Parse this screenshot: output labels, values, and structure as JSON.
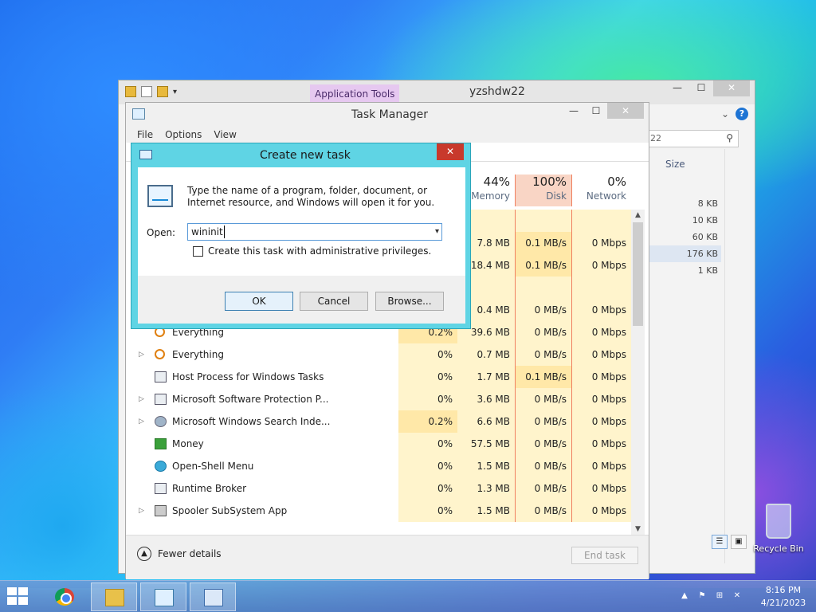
{
  "explorer": {
    "app_tools_label": "Application Tools",
    "title": "yzshdw22",
    "search_text": "22",
    "size_header": "Size",
    "sizes": [
      "8 KB",
      "10 KB",
      "60 KB",
      "176 KB",
      "1 KB"
    ],
    "selected_index": 3
  },
  "task_manager": {
    "title": "Task Manager",
    "menu": [
      "File",
      "Options",
      "View"
    ],
    "columns": {
      "memory": {
        "pct": "44%",
        "label": "Memory"
      },
      "disk": {
        "pct": "100%",
        "label": "Disk"
      },
      "network": {
        "pct": "0%",
        "label": "Network"
      }
    },
    "rows": [
      {
        "name": "",
        "cpu": "",
        "mem": "",
        "disk": "",
        "net": "",
        "icon": "none",
        "expander": false
      },
      {
        "name": "",
        "cpu": "",
        "mem": "7.8 MB",
        "disk": "0.1 MB/s",
        "net": "0 Mbps",
        "icon": "none",
        "expander": false
      },
      {
        "name": "",
        "cpu": "",
        "mem": "18.4 MB",
        "disk": "0.1 MB/s",
        "net": "0 Mbps",
        "icon": "none",
        "expander": false
      },
      {
        "name": "",
        "cpu": "",
        "mem": "",
        "disk": "",
        "net": "",
        "icon": "none",
        "expander": false
      },
      {
        "name": "",
        "cpu": "",
        "mem": "0.4 MB",
        "disk": "0 MB/s",
        "net": "0 Mbps",
        "icon": "none",
        "expander": false
      },
      {
        "name": "Everything",
        "cpu": "0.2%",
        "mem": "39.6 MB",
        "disk": "0 MB/s",
        "net": "0 Mbps",
        "icon": "search",
        "expander": false
      },
      {
        "name": "Everything",
        "cpu": "0%",
        "mem": "0.7 MB",
        "disk": "0 MB/s",
        "net": "0 Mbps",
        "icon": "search",
        "expander": true
      },
      {
        "name": "Host Process for Windows Tasks",
        "cpu": "0%",
        "mem": "1.7 MB",
        "disk": "0.1 MB/s",
        "net": "0 Mbps",
        "icon": "gen",
        "expander": false
      },
      {
        "name": "Microsoft Software Protection P...",
        "cpu": "0%",
        "mem": "3.6 MB",
        "disk": "0 MB/s",
        "net": "0 Mbps",
        "icon": "gen",
        "expander": true
      },
      {
        "name": "Microsoft Windows Search Inde...",
        "cpu": "0.2%",
        "mem": "6.6 MB",
        "disk": "0 MB/s",
        "net": "0 Mbps",
        "icon": "winsearch",
        "expander": true
      },
      {
        "name": "Money",
        "cpu": "0%",
        "mem": "57.5 MB",
        "disk": "0 MB/s",
        "net": "0 Mbps",
        "icon": "money",
        "expander": false
      },
      {
        "name": "Open-Shell Menu",
        "cpu": "0%",
        "mem": "1.5 MB",
        "disk": "0 MB/s",
        "net": "0 Mbps",
        "icon": "shell",
        "expander": false
      },
      {
        "name": "Runtime Broker",
        "cpu": "0%",
        "mem": "1.3 MB",
        "disk": "0 MB/s",
        "net": "0 Mbps",
        "icon": "gen",
        "expander": false
      },
      {
        "name": "Spooler SubSystem App",
        "cpu": "0%",
        "mem": "1.5 MB",
        "disk": "0 MB/s",
        "net": "0 Mbps",
        "icon": "printer",
        "expander": true
      }
    ],
    "fewer_details_label": "Fewer details",
    "end_task_label": "End task"
  },
  "dialog": {
    "title": "Create new task",
    "prompt": "Type the name of a program, folder, document, or Internet resource, and Windows will open it for you.",
    "open_label": "Open:",
    "open_value": "wininit",
    "admin_label": "Create this task with administrative privileges.",
    "admin_checked": false,
    "ok_label": "OK",
    "cancel_label": "Cancel",
    "browse_label": "Browse..."
  },
  "desktop": {
    "recycle_bin_label": "Recycle Bin"
  },
  "taskbar": {
    "time": "8:16 PM",
    "date": "4/21/2023"
  },
  "colors": {
    "disk_highlight": "#f9d5c5",
    "disk_border": "#f08060",
    "heat_light": "#fff4cc",
    "heat_medium": "#ffe8a8",
    "dialog_frame": "#5fd4e4",
    "close_red": "#c8392c"
  }
}
